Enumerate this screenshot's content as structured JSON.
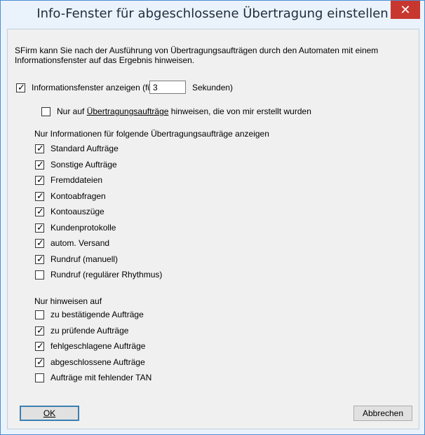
{
  "window": {
    "title": "Info-Fenster für abgeschlossene Übertragung einstellen",
    "close_glyph": "✕"
  },
  "intro": "SFirm kann Sie nach der Ausführung von Übertragungsaufträgen durch den Automaten mit einem Informationsfenster auf das Ergebnis hinweisen.",
  "show_window": {
    "checked": true,
    "label_before": "Informationsfenster anzeigen  (für",
    "seconds_value": "3",
    "label_after": "Sekunden)"
  },
  "only_mine": {
    "checked": false,
    "label_prefix": "Nur auf ",
    "label_link": "Übertragungsaufträge",
    "label_suffix": " hinweisen, die von mir erstellt wurden"
  },
  "types_heading": "Nur Informationen für folgende Übertragungsaufträge anzeigen",
  "types": [
    {
      "label": "Standard Aufträge",
      "checked": true
    },
    {
      "label": "Sonstige Aufträge",
      "checked": true
    },
    {
      "label": "Fremddateien",
      "checked": true
    },
    {
      "label": "Kontoabfragen",
      "checked": true
    },
    {
      "label": "Kontoauszüge",
      "checked": true
    },
    {
      "label": "Kundenprotokolle",
      "checked": true
    },
    {
      "label": "autom. Versand",
      "checked": true
    },
    {
      "label": "Rundruf (manuell)",
      "checked": true
    },
    {
      "label": "Rundruf (regulärer Rhythmus)",
      "checked": false
    }
  ],
  "notify_heading": "Nur hinweisen auf",
  "notify": [
    {
      "label": "zu bestätigende Aufträge",
      "checked": false
    },
    {
      "label": "zu prüfende Aufträge",
      "checked": true
    },
    {
      "label": "fehlgeschlagene Aufträge",
      "checked": true
    },
    {
      "label": "abgeschlossene Aufträge",
      "checked": true
    },
    {
      "label": "Aufträge mit fehlender TAN",
      "checked": false
    }
  ],
  "buttons": {
    "ok": "OK",
    "cancel": "Abbrechen"
  },
  "check_glyph": "✓"
}
